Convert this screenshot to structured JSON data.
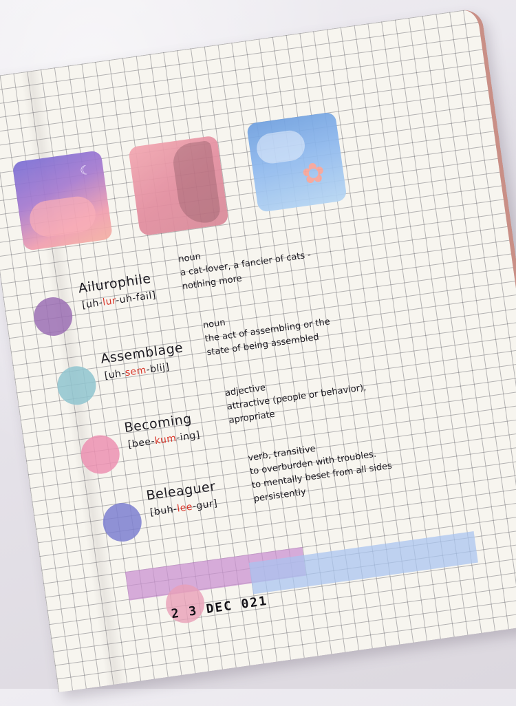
{
  "photos": [
    {
      "name": "sunset-cloud-photo",
      "moon": "☾"
    },
    {
      "name": "pink-flowers-photo"
    },
    {
      "name": "blue-sky-flower-photo",
      "flower": "✿"
    }
  ],
  "entries": [
    {
      "word": "Ailurophile",
      "pron_pre": "[uh-",
      "pron_stress": "lur",
      "pron_post": "-uh-fail]",
      "pos": "noun",
      "def_lines": [
        "a cat-lover, a fancier of cats -",
        "nothing more"
      ],
      "dot_color": "#9b6fb4"
    },
    {
      "word": "Assemblage",
      "pron_pre": "[uh-",
      "pron_stress": "sem",
      "pron_post": "-blij]",
      "pos": "noun",
      "def_lines": [
        "the act of assembling or the",
        "state of being assembled"
      ],
      "dot_color": "#8fc4cf"
    },
    {
      "word": "Becoming",
      "pron_pre": "[bee-",
      "pron_stress": "kum",
      "pron_post": "-ing]",
      "pos": "adjective",
      "def_lines": [
        "attractive (people or behavior),",
        "apropriate"
      ],
      "dot_color": "#ec91b1"
    },
    {
      "word": "Beleaguer",
      "pron_pre": "[buh-",
      "pron_stress": "lee",
      "pron_post": "-gur]",
      "pos": "verb, transitive",
      "def_lines": [
        "to overburden with troubles.",
        "to mentally beset from all sides",
        "persistently"
      ],
      "dot_color": "#7d7fd0"
    }
  ],
  "date_stamp": "2 3 DEC  021",
  "colors": {
    "tape_purple": "#c98fd0",
    "tape_blue": "#a8c4f0",
    "stamp_circle": "#e9a0b8",
    "stress": "#d8362a"
  }
}
